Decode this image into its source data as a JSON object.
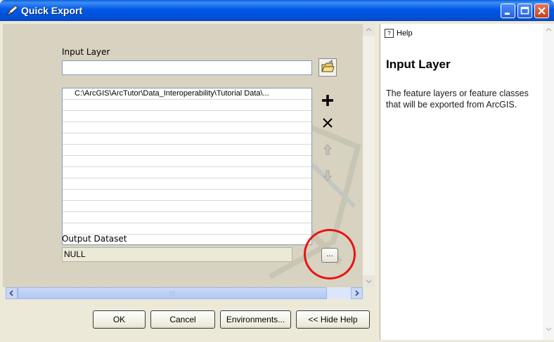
{
  "window": {
    "title": "Quick Export"
  },
  "form": {
    "input_layer_label": "Input Layer",
    "input_layer_value": "",
    "list_items": [
      "C:\\ArcGIS\\ArcTutor\\Data_Interoperability\\Tutorial Data\\...",
      "",
      "",
      "",
      "",
      "",
      "",
      "",
      "",
      "",
      "",
      "",
      ""
    ],
    "output_dataset_label": "Output Dataset",
    "output_dataset_value": "NULL",
    "browse_label": "..."
  },
  "buttons": {
    "ok": "OK",
    "cancel": "Cancel",
    "environments": "Environments...",
    "hide_help": "<< Hide Help"
  },
  "help": {
    "tab_label": "Help",
    "title": "Input Layer",
    "body": "The feature layers or feature classes that will be exported from ArcGIS."
  },
  "colors": {
    "titlebar": "#0058e6",
    "highlight_circle": "#e81313",
    "dialog_bg": "#ece9d8"
  }
}
